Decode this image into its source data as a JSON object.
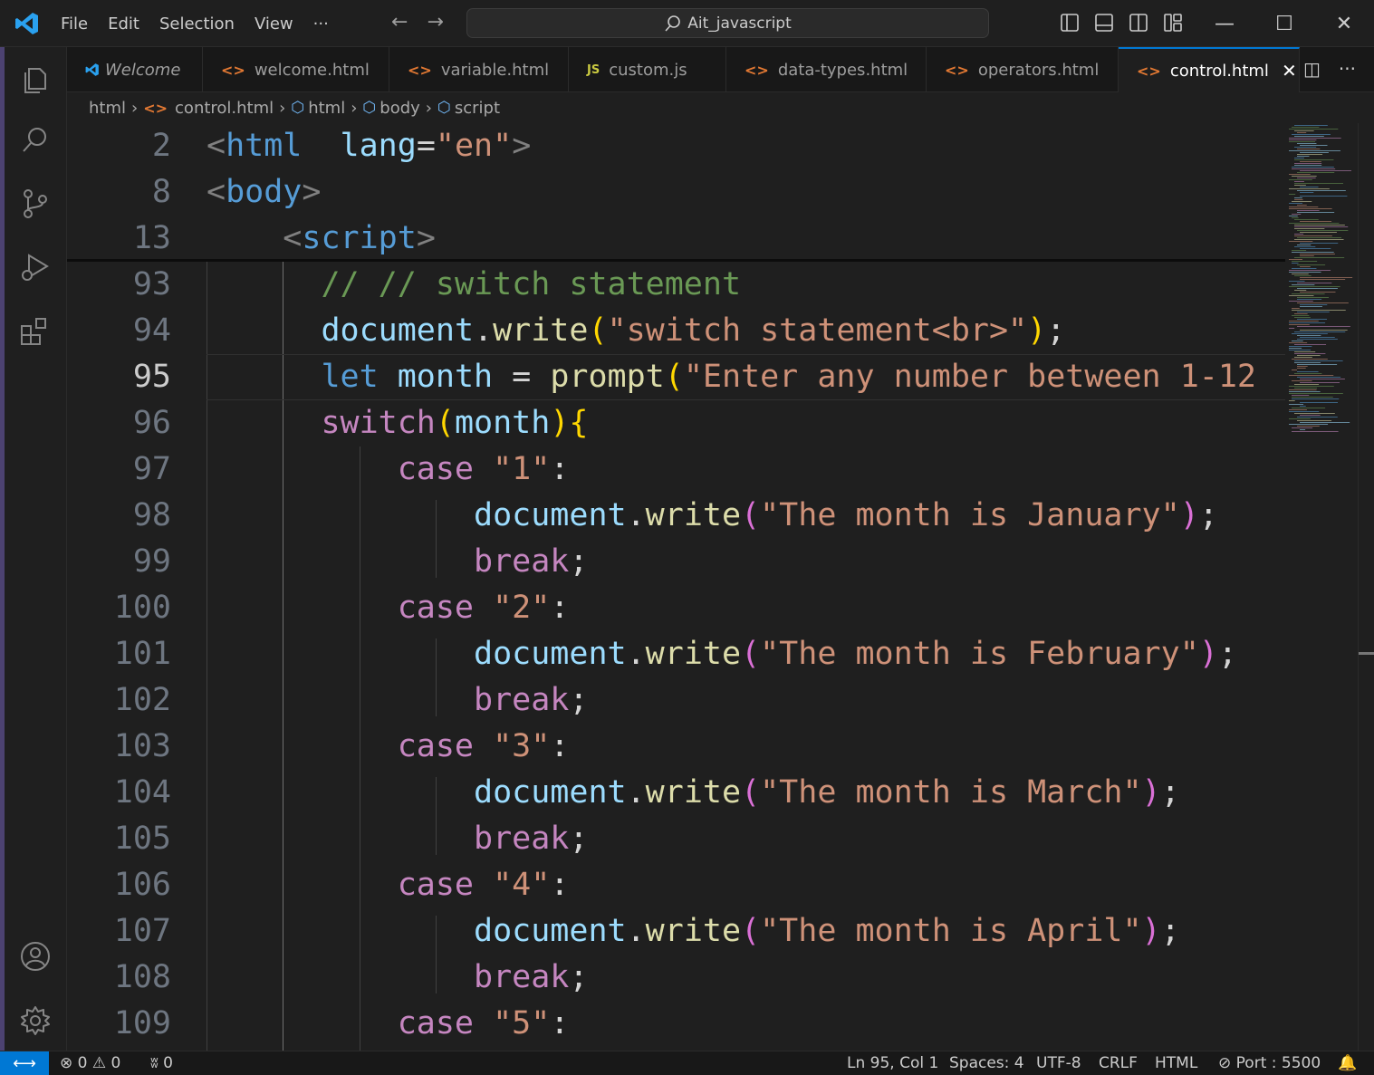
{
  "titlebar": {
    "menu": [
      "File",
      "Edit",
      "Selection",
      "View",
      "···"
    ],
    "search_text": "Ait_javascript",
    "controls": {
      "minimize": "—",
      "maximize": "☐",
      "close": "✕"
    },
    "nav_back": "←",
    "nav_forward": "→"
  },
  "tabs": [
    {
      "label": "Welcome",
      "icon": "vscode-icon",
      "italic": true,
      "active": false
    },
    {
      "label": "welcome.html",
      "icon": "html-icon",
      "active": false
    },
    {
      "label": "variable.html",
      "icon": "html-icon",
      "active": false
    },
    {
      "label": "custom.js",
      "icon": "js-icon",
      "active": false
    },
    {
      "label": "data-types.html",
      "icon": "html-icon",
      "active": false
    },
    {
      "label": "operators.html",
      "icon": "html-icon",
      "active": false
    },
    {
      "label": "control.html",
      "icon": "html-icon",
      "active": true
    }
  ],
  "tab_glyphs": {
    "html": "<>",
    "js": "JS",
    "close": "✕"
  },
  "editor_actions": {
    "split": "◫",
    "more": "···"
  },
  "breadcrumb": [
    "html",
    "control.html",
    "html",
    "body",
    "script"
  ],
  "sticky_lines": [
    {
      "num": "2",
      "tokens": [
        [
          "t-br",
          "<"
        ],
        [
          "t-tag",
          "html"
        ],
        [
          "",
          "  "
        ],
        [
          "t-attr",
          "lang"
        ],
        [
          "",
          "="
        ],
        [
          "t-str",
          "\"en\""
        ],
        [
          "t-br",
          ">"
        ]
      ]
    },
    {
      "num": "8",
      "tokens": [
        [
          "t-br",
          "<"
        ],
        [
          "t-tag",
          "body"
        ],
        [
          "t-br",
          ">"
        ]
      ]
    },
    {
      "num": "13",
      "indent": "    ",
      "tokens": [
        [
          "t-br",
          "<"
        ],
        [
          "t-tag",
          "script"
        ],
        [
          "t-br",
          ">"
        ]
      ]
    }
  ],
  "code_lines": [
    {
      "num": "93",
      "indent": "      ",
      "tokens": [
        [
          "t-cmt",
          "// // switch statement"
        ]
      ]
    },
    {
      "num": "94",
      "indent": "      ",
      "tokens": [
        [
          "t-obj",
          "document"
        ],
        [
          "",
          "."
        ],
        [
          "t-fn",
          "write"
        ],
        [
          "t-p1",
          "("
        ],
        [
          "t-str",
          "\"switch statement<br>\""
        ],
        [
          "t-p1",
          ")"
        ],
        [
          "",
          ";"
        ]
      ]
    },
    {
      "num": "95",
      "indent": "      ",
      "current": true,
      "tokens": [
        [
          "t-kw",
          "let"
        ],
        [
          "",
          " "
        ],
        [
          "t-var",
          "month"
        ],
        [
          "",
          " = "
        ],
        [
          "t-fn",
          "prompt"
        ],
        [
          "t-p1",
          "("
        ],
        [
          "t-str",
          "\"Enter any number between 1-12"
        ]
      ]
    },
    {
      "num": "96",
      "indent": "      ",
      "tokens": [
        [
          "t-ctl",
          "switch"
        ],
        [
          "t-p1",
          "("
        ],
        [
          "t-var",
          "month"
        ],
        [
          "t-p1",
          ")"
        ],
        [
          "t-p1",
          "{"
        ]
      ]
    },
    {
      "num": "97",
      "indent": "          ",
      "tokens": [
        [
          "t-ctl",
          "case"
        ],
        [
          "",
          " "
        ],
        [
          "t-str",
          "\"1\""
        ],
        [
          "",
          ":"
        ]
      ]
    },
    {
      "num": "98",
      "indent": "              ",
      "tokens": [
        [
          "t-obj",
          "document"
        ],
        [
          "",
          "."
        ],
        [
          "t-fn",
          "write"
        ],
        [
          "t-p2",
          "("
        ],
        [
          "t-str",
          "\"The month is January\""
        ],
        [
          "t-p2",
          ")"
        ],
        [
          "",
          ";"
        ]
      ]
    },
    {
      "num": "99",
      "indent": "              ",
      "tokens": [
        [
          "t-ctl",
          "break"
        ],
        [
          "",
          ";"
        ]
      ]
    },
    {
      "num": "100",
      "indent": "          ",
      "tokens": [
        [
          "t-ctl",
          "case"
        ],
        [
          "",
          " "
        ],
        [
          "t-str",
          "\"2\""
        ],
        [
          "",
          ":"
        ]
      ]
    },
    {
      "num": "101",
      "indent": "              ",
      "tokens": [
        [
          "t-obj",
          "document"
        ],
        [
          "",
          "."
        ],
        [
          "t-fn",
          "write"
        ],
        [
          "t-p2",
          "("
        ],
        [
          "t-str",
          "\"The month is February\""
        ],
        [
          "t-p2",
          ")"
        ],
        [
          "",
          ";"
        ]
      ]
    },
    {
      "num": "102",
      "indent": "              ",
      "tokens": [
        [
          "t-ctl",
          "break"
        ],
        [
          "",
          ";"
        ]
      ]
    },
    {
      "num": "103",
      "indent": "          ",
      "tokens": [
        [
          "t-ctl",
          "case"
        ],
        [
          "",
          " "
        ],
        [
          "t-str",
          "\"3\""
        ],
        [
          "",
          ":"
        ]
      ]
    },
    {
      "num": "104",
      "indent": "              ",
      "tokens": [
        [
          "t-obj",
          "document"
        ],
        [
          "",
          "."
        ],
        [
          "t-fn",
          "write"
        ],
        [
          "t-p2",
          "("
        ],
        [
          "t-str",
          "\"The month is March\""
        ],
        [
          "t-p2",
          ")"
        ],
        [
          "",
          ";"
        ]
      ]
    },
    {
      "num": "105",
      "indent": "              ",
      "tokens": [
        [
          "t-ctl",
          "break"
        ],
        [
          "",
          ";"
        ]
      ]
    },
    {
      "num": "106",
      "indent": "          ",
      "tokens": [
        [
          "t-ctl",
          "case"
        ],
        [
          "",
          " "
        ],
        [
          "t-str",
          "\"4\""
        ],
        [
          "",
          ":"
        ]
      ]
    },
    {
      "num": "107",
      "indent": "              ",
      "tokens": [
        [
          "t-obj",
          "document"
        ],
        [
          "",
          "."
        ],
        [
          "t-fn",
          "write"
        ],
        [
          "t-p2",
          "("
        ],
        [
          "t-str",
          "\"The month is April\""
        ],
        [
          "t-p2",
          ")"
        ],
        [
          "",
          ";"
        ]
      ]
    },
    {
      "num": "108",
      "indent": "              ",
      "tokens": [
        [
          "t-ctl",
          "break"
        ],
        [
          "",
          ";"
        ]
      ]
    },
    {
      "num": "109",
      "indent": "          ",
      "tokens": [
        [
          "t-ctl",
          "case"
        ],
        [
          "",
          " "
        ],
        [
          "t-str",
          "\"5\""
        ],
        [
          "",
          ":"
        ]
      ]
    }
  ],
  "statusbar": {
    "remote_icon": "⟷",
    "errors_icon": "⊗",
    "errors": "0",
    "warnings_icon": "⚠",
    "warnings": "0",
    "ports_icon": "ʬ",
    "ports": "0",
    "position": "Ln 95, Col 1",
    "spaces": "Spaces: 4",
    "encoding": "UTF-8",
    "eol": "CRLF",
    "language": "HTML",
    "port_icon": "⊘",
    "port": "Port : 5500",
    "bell_icon": "🔔"
  },
  "colors": {
    "accent": "#0078d4",
    "editor_bg": "#1f1f1f",
    "html_icon": "#e37933"
  }
}
